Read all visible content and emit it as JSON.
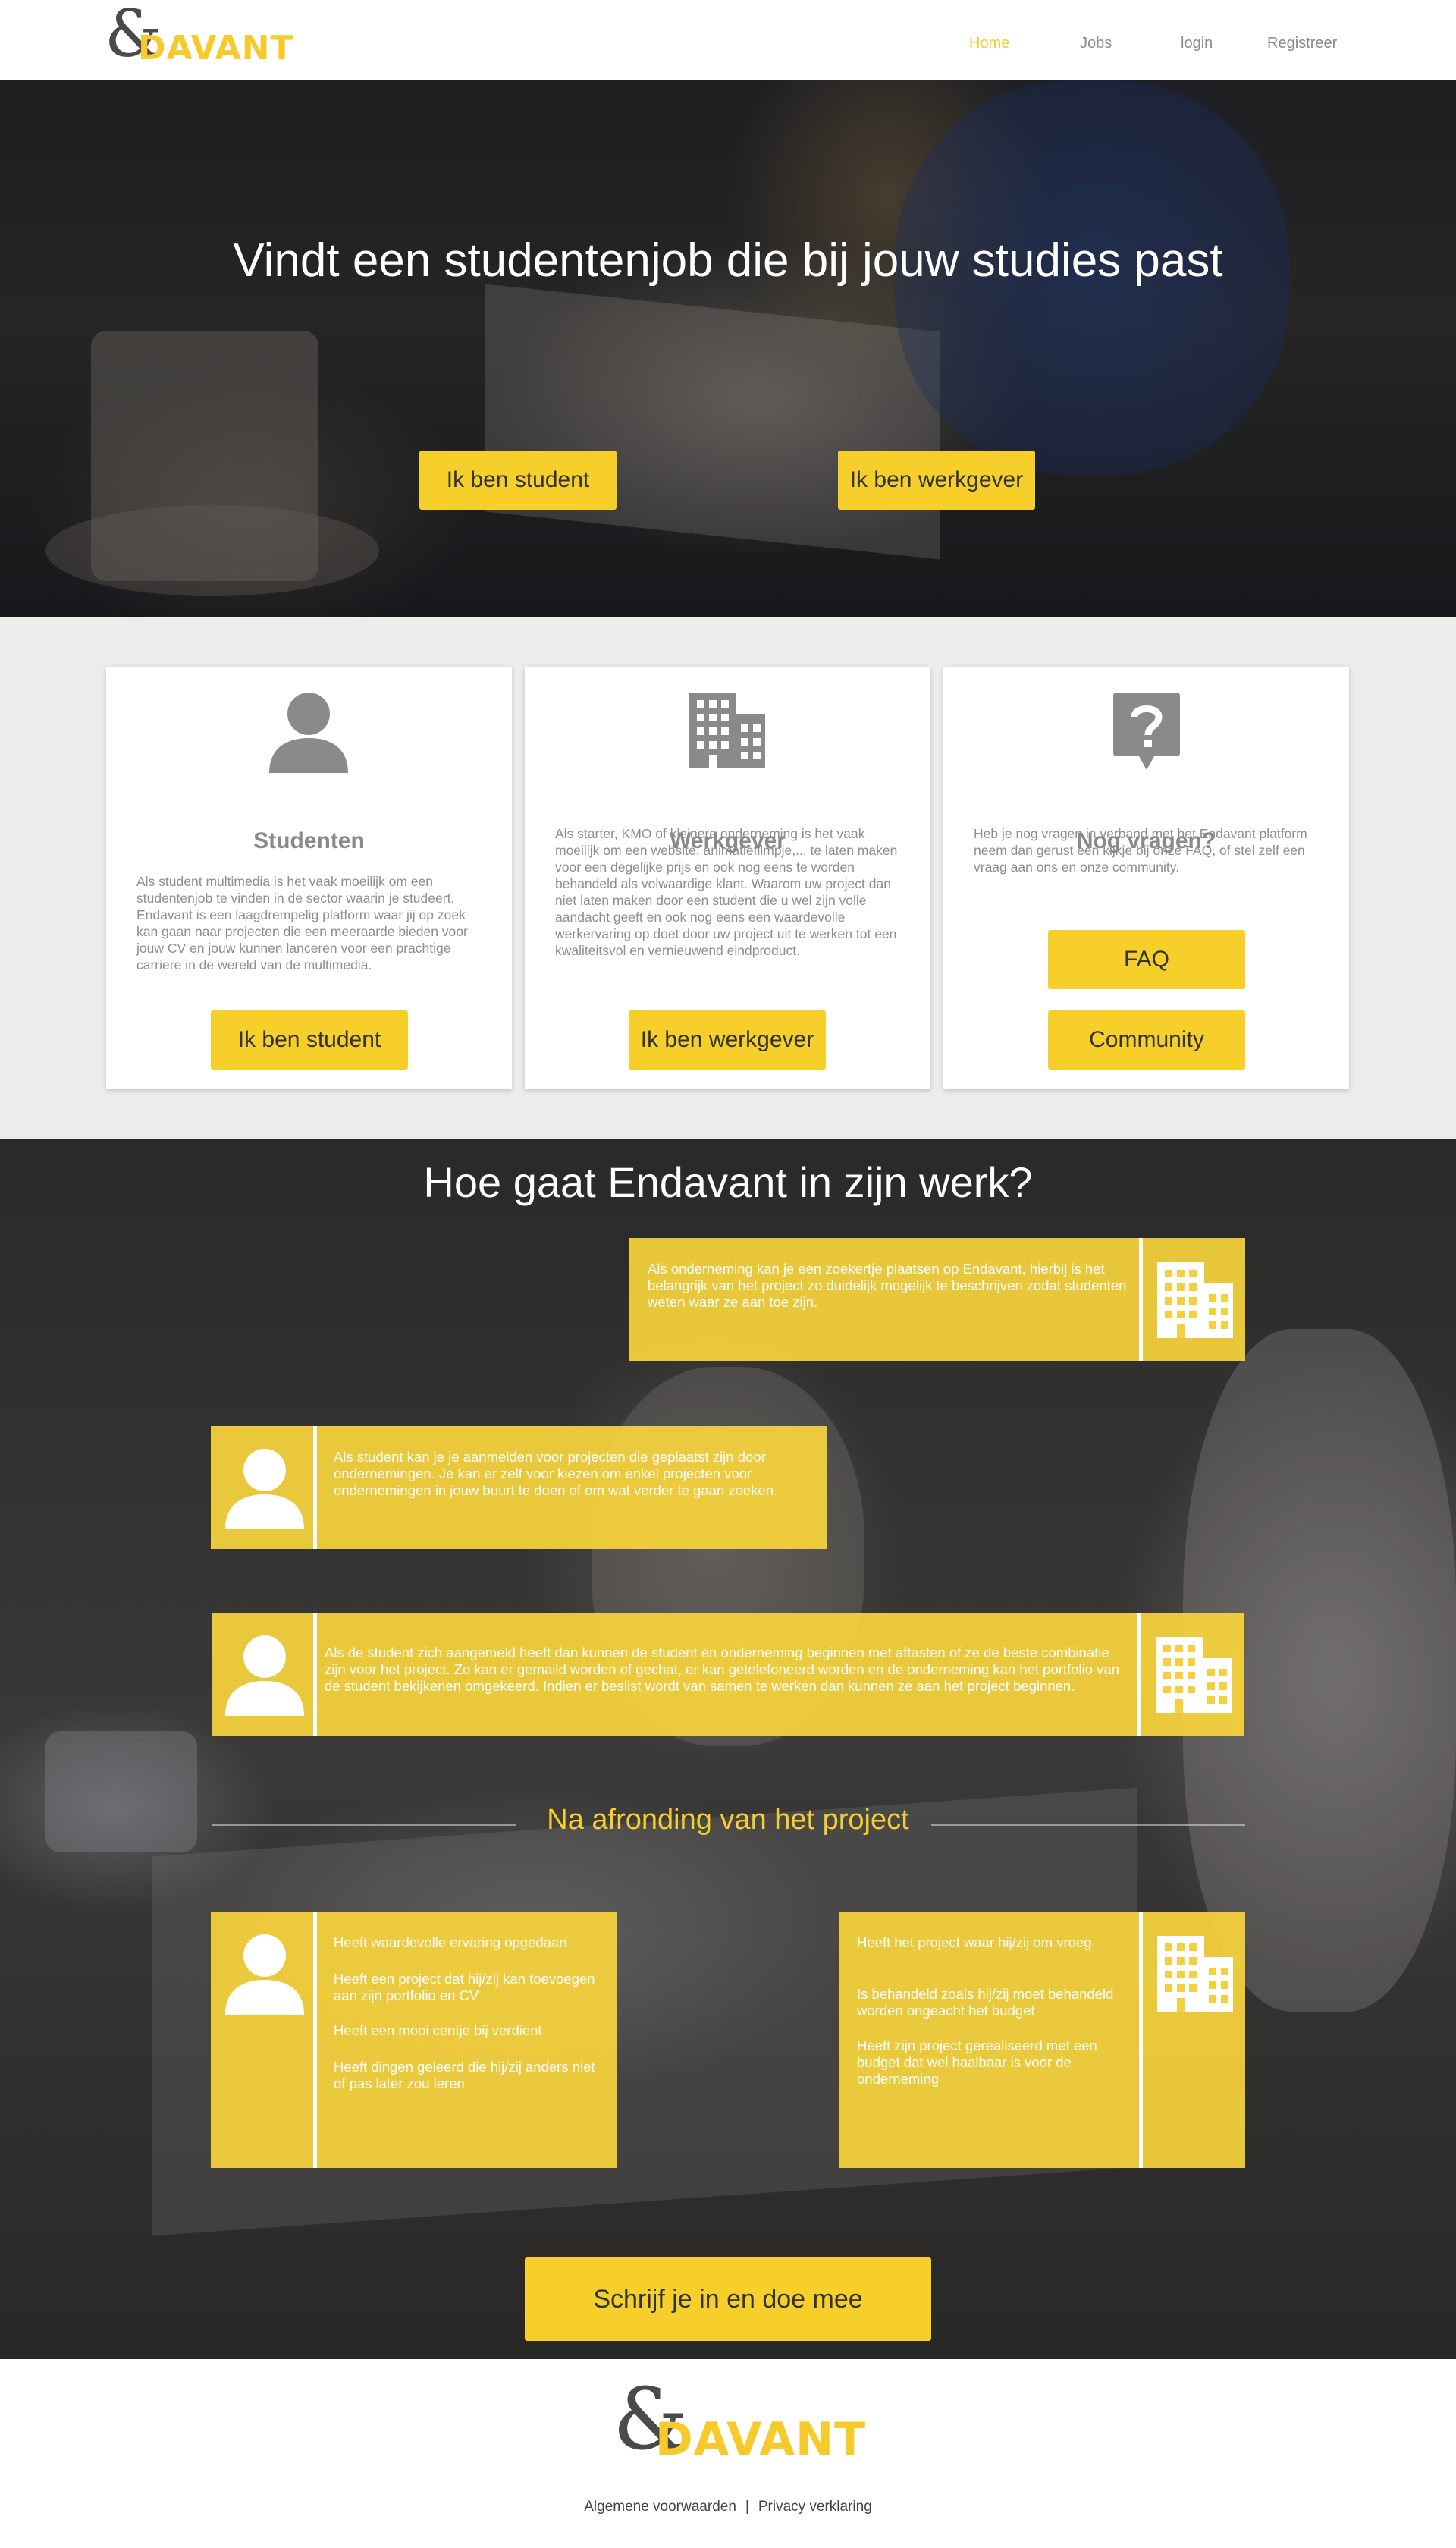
{
  "brand": {
    "logo_amp": "&",
    "logo_word": "DAVANT"
  },
  "nav": {
    "items": [
      {
        "label": "Home",
        "active": true
      },
      {
        "label": "Jobs"
      },
      {
        "label": "login"
      },
      {
        "label": "Registreer"
      }
    ]
  },
  "hero": {
    "title": "Vindt een studentenjob die bij jouw studies past",
    "btn_student": "Ik ben student",
    "btn_employer": "Ik ben werkgever"
  },
  "cards": [
    {
      "icon": "person-icon",
      "title": "Studenten",
      "text": "Als student multimedia is het vaak moeilijk om een studentenjob te vinden in de sector waarin je studeert. Endavant is een laagdrempelig platform waar jij op zoek kan gaan naar projecten die een meeraarde bieden voor jouw CV en jouw kunnen lanceren voor een prachtige carriere in de wereld van de multimedia.",
      "button": "Ik ben student"
    },
    {
      "icon": "building-icon",
      "title": "Werkgever",
      "text": "Als starter, KMO of kleinere onderneming is het vaak moeilijk om een website, animatiefilmpje,... te laten maken voor een degelijke prijs en ook nog eens te worden behandeld als volwaardige klant. Waarom uw project dan niet laten maken door een student die u wel zijn volle aandacht geeft en ook nog eens een waardevolle werkervaring op doet door uw project uit te werken tot een kwaliteitsvol en vernieuwend eindproduct.",
      "button": "Ik ben werkgever"
    },
    {
      "icon": "question-bubble-icon",
      "title": "Nog vragen?",
      "text": "Heb je nog vragen in verband met het Endavant platform neem dan gerust een kijkje bij onze FAQ, of stel zelf een vraag aan ons en onze community.",
      "button_faq": "FAQ",
      "button_community": "Community"
    }
  ],
  "how": {
    "title": "Hoe gaat Endavant in zijn werk?",
    "step1": "Als onderneming kan je een zoekertje plaatsen op Endavant, hierbij is het belangrijk van het project zo  duidelijk mogelijk te beschrijven zodat studenten weten waar ze aan toe zijn.",
    "step2": "Als student kan je je aanmelden voor projecten die geplaatst zijn door ondernemingen. Je kan er zelf voor kiezen om enkel projecten voor ondernemingen in jouw buurt te doen of om wat verder te gaan zoeken.",
    "step3": "Als de student zich aangemeld heeft dan kunnen de student en onderneming beginnen met aftasten of ze de beste combinatie zijn voor het project. Zo kan er gemaild worden of gechat, er kan getelefoneerd worden en de onderneming kan het portfolio van de student bekijkenen omgekeerd. Indien er beslist wordt van samen te werken dan kunnen ze aan het project beginnen.",
    "after_title": "Na afronding van het project",
    "student_bullets": [
      "Heeft waardevolle ervaring opgedaan",
      "Heeft een project dat hij/zij kan toevoegen aan zijn portfolio en CV",
      "Heeft een mooi centje bij verdient",
      "Heeft dingen geleerd die hij/zij anders niet of pas later zou leren"
    ],
    "company_bullets": [
      "Heeft het project waar hij/zij om vroeg",
      "Is behandeld zoals hij/zij moet behandeld worden ongeacht het budget",
      "Heeft zijn project gerealiseerd met een budget dat wel haalbaar is voor de onderneming"
    ],
    "cta": "Schrijf je in en doe mee"
  },
  "footer": {
    "terms": "Algemene voorwaarden",
    "separator": "|",
    "privacy": "Privacy verklaring"
  },
  "colors": {
    "accent": "#f7cf2a",
    "panel": "#fad53c",
    "card_bg": "#ffffff",
    "section_bg": "#eeecea",
    "icon_gray": "#8a8a8a"
  }
}
